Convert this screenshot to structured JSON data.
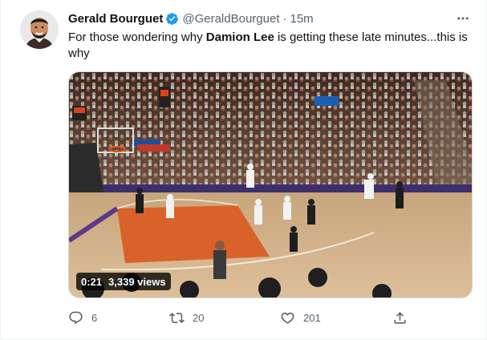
{
  "tweet": {
    "display_name": "Gerald Bourguet",
    "handle": "@GeraldBourguet",
    "separator": "·",
    "time": "15m",
    "text_before": "For those wondering why ",
    "text_bold": "Damion Lee",
    "text_after": " is getting these late minutes...this is why"
  },
  "media": {
    "duration": "0:21",
    "views": "3,339 views"
  },
  "actions": {
    "reply_count": "6",
    "retweet_count": "20",
    "like_count": "201"
  },
  "icons": {
    "verified": "verified-badge-icon",
    "more": "more-dots-icon",
    "reply": "reply-icon",
    "retweet": "retweet-icon",
    "like": "heart-icon",
    "share": "share-icon"
  },
  "colors": {
    "accent": "#1d9bf0",
    "text": "#0f1419",
    "secondary": "#536471"
  }
}
